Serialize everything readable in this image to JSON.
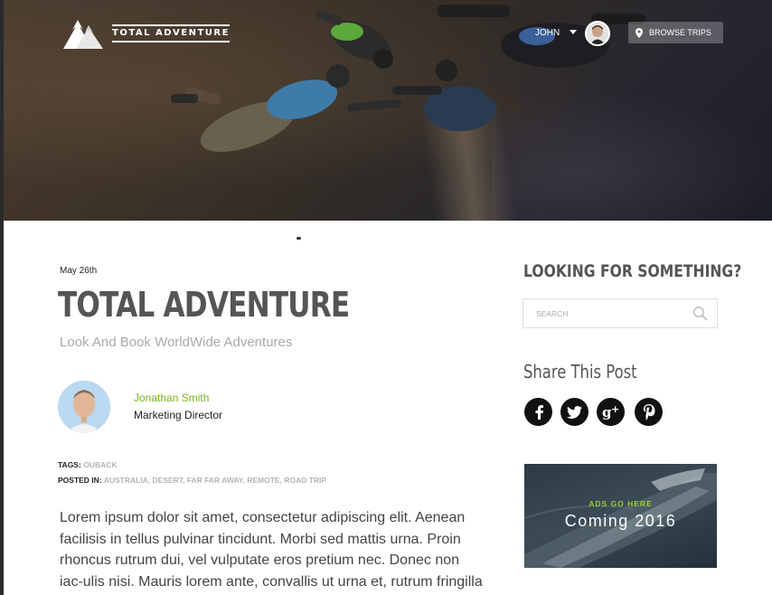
{
  "brand": {
    "name": "TOTAL ADVENTURE"
  },
  "nav": {
    "user_name": "JOHN",
    "browse_label": "BROWSE TRIPS"
  },
  "post": {
    "date": "May 26th",
    "title": "TOTAL ADVENTURE",
    "subtitle": "Look And Book WorldWide Adventures",
    "author": {
      "name": "Jonathan Smith",
      "role": "Marketing Director"
    },
    "tags_label": "TAGS:",
    "tags_values": "OUBACK",
    "posted_label": "POSTED IN:",
    "posted_values": "AUSTRALIA, DESERT, FAR FAR AWAY, REMOTE, ROAD TRIP",
    "body": "Lorem ipsum dolor sit amet, consectetur adipiscing elit. Aenean facilisis in tellus pulvinar tincidunt. Morbi sed mattis urna. Proin rhoncus rutrum dui, vel vulputate eros pretium nec. Donec non iac-ulis nisi. Mauris lorem ante, convallis ut urna et, rutrum fringilla"
  },
  "sidebar": {
    "search_heading": "LOOKING FOR SOMETHING?",
    "search_placeholder": "SEARCH",
    "share_heading": "Share This Post",
    "social": [
      "facebook-icon",
      "twitter-icon",
      "google-plus-icon",
      "pinterest-icon"
    ],
    "ad": {
      "label": "ADS GO HERE",
      "title": "Coming 2016"
    }
  },
  "colors": {
    "accent_green": "#7cb51b",
    "ad_label_green": "#9acd32",
    "heading_gray": "#555555"
  }
}
